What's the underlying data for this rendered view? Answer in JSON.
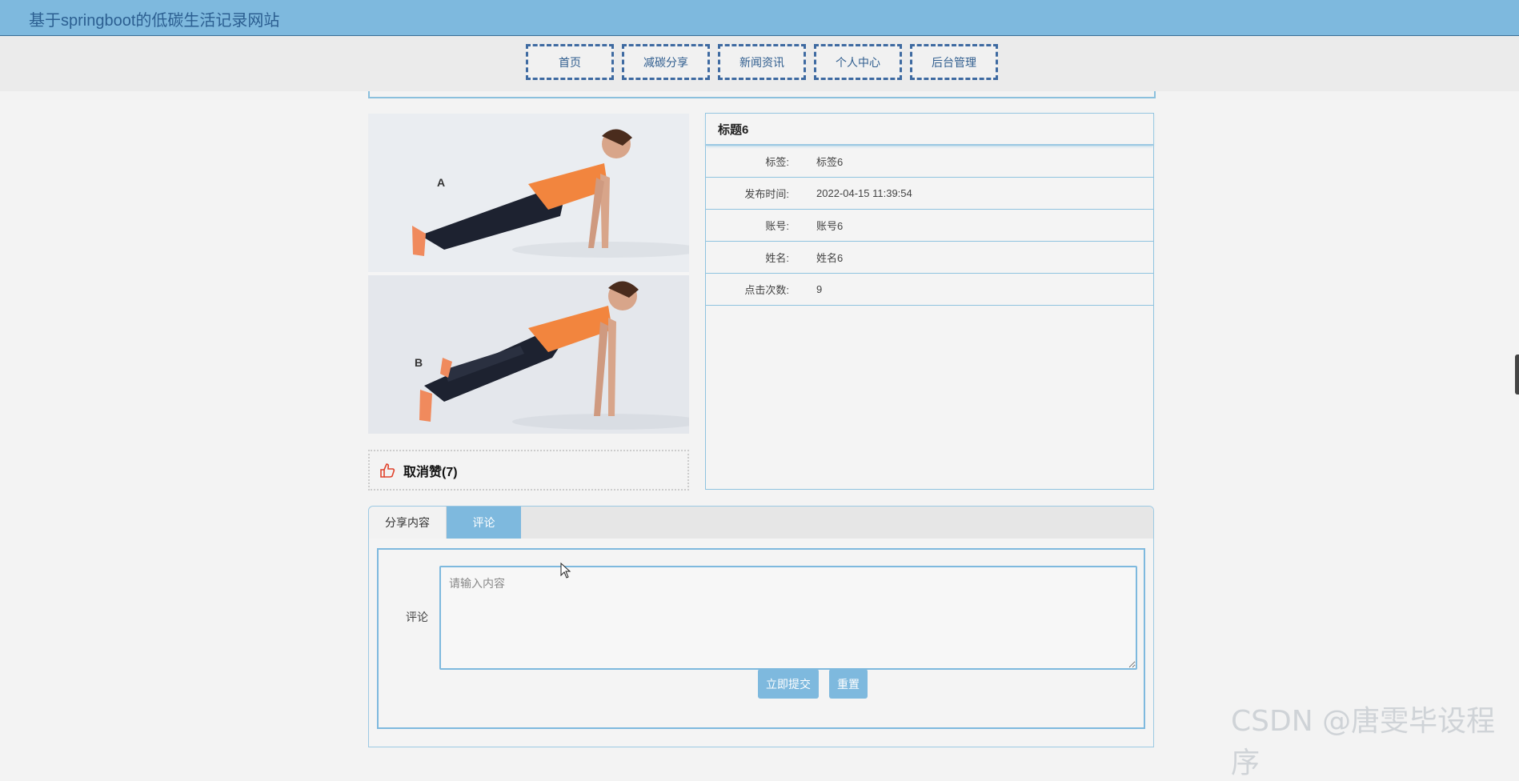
{
  "header": {
    "title": "基于springboot的低碳生活记录网站"
  },
  "nav": {
    "items": [
      {
        "label": "首页"
      },
      {
        "label": "减碳分享"
      },
      {
        "label": "新闻资讯"
      },
      {
        "label": "个人中心"
      },
      {
        "label": "后台管理"
      }
    ]
  },
  "image": {
    "labels": [
      "A",
      "B"
    ]
  },
  "like": {
    "label": "取消赞(7)"
  },
  "details": {
    "title": "标题6",
    "rows": [
      {
        "label": "标签:",
        "value": "标签6"
      },
      {
        "label": "发布时间:",
        "value": "2022-04-15 11:39:54"
      },
      {
        "label": "账号:",
        "value": "账号6"
      },
      {
        "label": "姓名:",
        "value": "姓名6"
      },
      {
        "label": "点击次数:",
        "value": "9"
      }
    ]
  },
  "tabs": [
    {
      "label": "分享内容"
    },
    {
      "label": "评论"
    }
  ],
  "comment_form": {
    "label": "评论",
    "placeholder": "请输入内容",
    "submit_label": "立即提交",
    "reset_label": "重置"
  },
  "watermark": "CSDN @唐雯毕设程序",
  "colors": {
    "header_bg": "#7eb9de",
    "nav_border": "#3e6aa1",
    "accent": "#7eb9de"
  }
}
